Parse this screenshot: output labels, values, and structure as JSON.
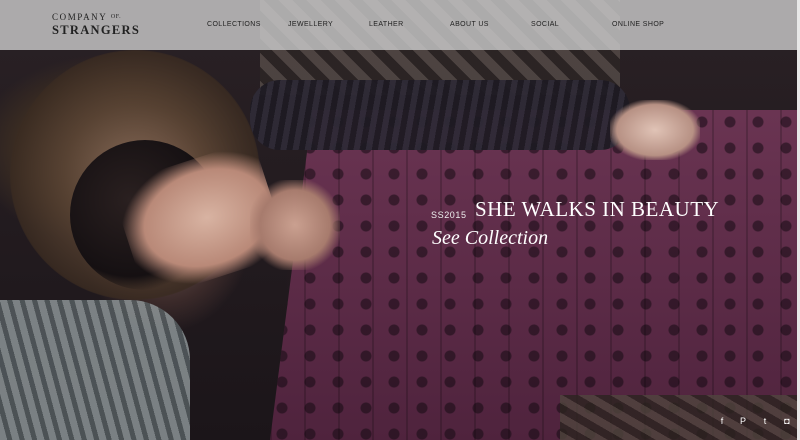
{
  "brand": {
    "line1": "COMPANY",
    "of": "OF.",
    "line2": "STRANGERS"
  },
  "nav": {
    "items": [
      "COLLECTIONS",
      "JEWELLERY",
      "LEATHER",
      "ABOUT US",
      "SOCIAL",
      "ONLINE SHOP"
    ]
  },
  "hero": {
    "season": "SS2015",
    "headline": "SHE WALKS IN BEAUTY",
    "link": "See Collection"
  },
  "social": {
    "icons": [
      "facebook-icon",
      "pinterest-icon",
      "twitter-icon",
      "instagram-icon"
    ],
    "glyphs": [
      "f",
      "P",
      "t",
      "◘"
    ]
  },
  "colors": {
    "navbar": "#cdcdcd",
    "text_dark": "#222222",
    "hero_text": "#ffffff",
    "dress": "#5c2b45"
  }
}
